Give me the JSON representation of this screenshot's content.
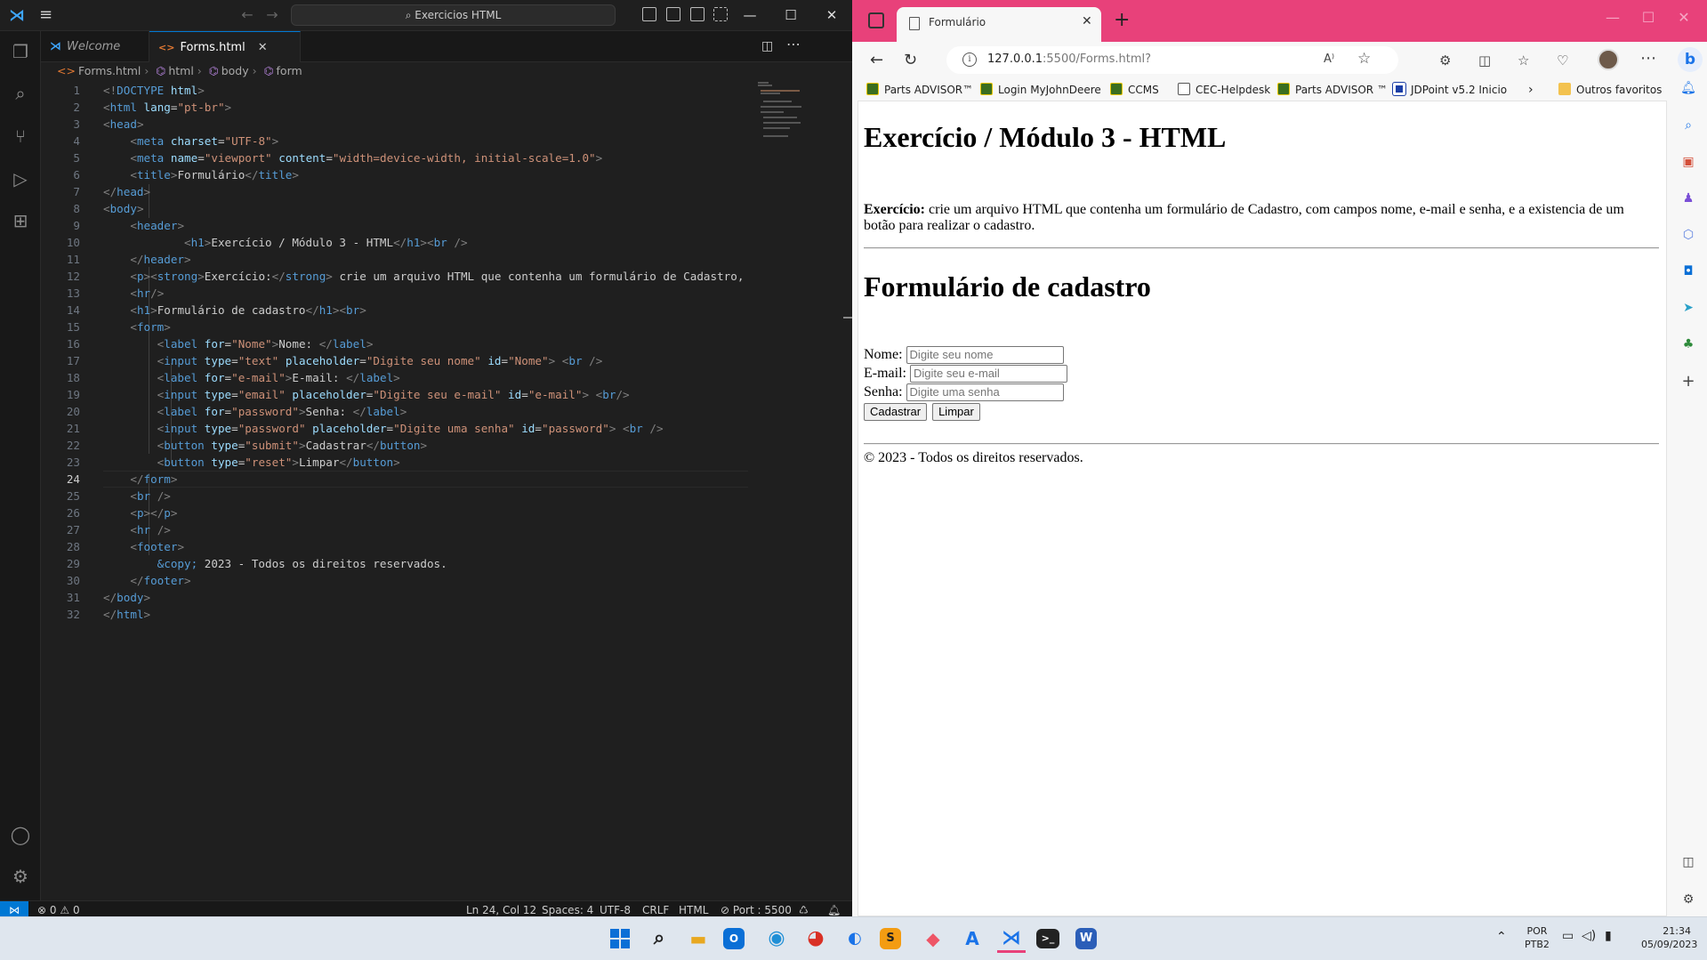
{
  "vscode": {
    "title_search": "Exercicios HTML",
    "tabs": [
      {
        "label": "Welcome"
      },
      {
        "label": "Forms.html"
      }
    ],
    "breadcrumb": [
      "Forms.html",
      "html",
      "body",
      "form"
    ],
    "line_numbers": [
      "1",
      "2",
      "3",
      "4",
      "5",
      "6",
      "7",
      "8",
      "9",
      "10",
      "11",
      "12",
      "13",
      "14",
      "15",
      "16",
      "17",
      "18",
      "19",
      "20",
      "21",
      "22",
      "23",
      "24",
      "25",
      "26",
      "27",
      "28",
      "29",
      "30",
      "31",
      "32"
    ],
    "current_line": "24",
    "status": {
      "errors": "0",
      "warnings": "0",
      "position": "Ln 24, Col 12",
      "spaces": "Spaces: 4",
      "encoding": "UTF-8",
      "eol": "CRLF",
      "language": "HTML",
      "port": "Port : 5500"
    }
  },
  "browser": {
    "tab_title": "Formulário",
    "url_host": "127.0.0.1",
    "url_rest": ":5500/Forms.html?",
    "favorites": [
      {
        "label": "Parts ADVISOR™",
        "icon": "jd"
      },
      {
        "label": "Login MyJohnDeere",
        "icon": "jd"
      },
      {
        "label": "CCMS",
        "icon": "jd"
      },
      {
        "label": "CEC-Helpdesk",
        "icon": "doc"
      },
      {
        "label": "Parts ADVISOR ™",
        "icon": "jd"
      },
      {
        "label": "JDPoint v5.2 Inicio",
        "icon": "jdp"
      }
    ],
    "other_favorites": "Outros favoritos",
    "page": {
      "h1": "Exercício / Módulo 3 - HTML",
      "paragraph_strong": "Exercício:",
      "paragraph_text": " crie um arquivo HTML que contenha um formulário de Cadastro, com campos nome, e-mail e senha, e a existencia de um botão para realizar o cadastro.",
      "h2": "Formulário de cadastro",
      "fields": [
        {
          "label": "Nome:",
          "placeholder": "Digite seu nome"
        },
        {
          "label": "E-mail:",
          "placeholder": "Digite seu e-mail"
        },
        {
          "label": "Senha:",
          "placeholder": "Digite uma senha"
        }
      ],
      "submit_label": "Cadastrar",
      "reset_label": "Limpar",
      "footer": "© 2023 - Todos os direitos reservados."
    }
  },
  "taskbar": {
    "lang_top": "POR",
    "lang_bottom": "PTB2",
    "time": "21:34",
    "date": "05/09/2023"
  },
  "colors": {
    "edge_accent": "#e8417a",
    "vscode_accent": "#0078d4",
    "editor_bg": "#1f1f1f"
  }
}
